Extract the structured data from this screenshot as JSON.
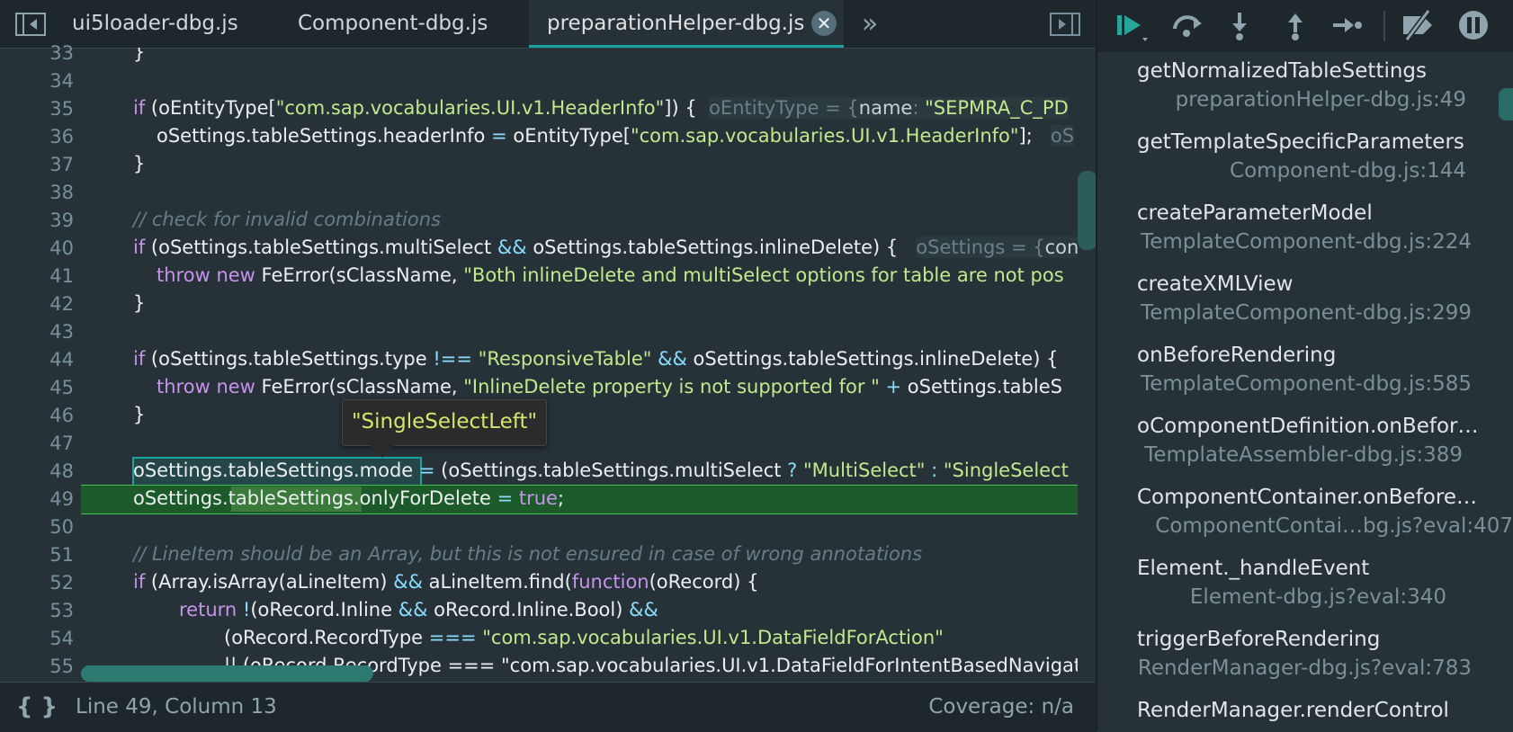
{
  "tabs": [
    {
      "label": "ui5loader-dbg.js",
      "active": false
    },
    {
      "label": "Component-dbg.js",
      "active": false
    },
    {
      "label": "preparationHelper-dbg.js",
      "active": true
    }
  ],
  "tab_close_glyph": "✕",
  "tab_overflow_glyph": "»",
  "gutter": [
    "33",
    "34",
    "35",
    "36",
    "37",
    "38",
    "39",
    "40",
    "41",
    "42",
    "43",
    "44",
    "45",
    "46",
    "47",
    "48",
    "49",
    "50",
    "51",
    "52",
    "53",
    "54",
    "55"
  ],
  "code": {
    "l33": "}",
    "l35_a": "if",
    "l35_b": " (oEntityType[",
    "l35_c": "\"com.sap.vocabularies.UI.v1.HeaderInfo\"",
    "l35_d": "]) {",
    "l35_hint_a": "oEntityType = {",
    "l35_hint_b": "name",
    "l35_hint_c": ": ",
    "l35_hint_d": "\"SEPMRA_C_PD",
    "l36_a": "oSettings.tableSettings.headerInfo ",
    "l36_b": "=",
    "l36_c": " oEntityType[",
    "l36_d": "\"com.sap.vocabularies.UI.v1.HeaderInfo\"",
    "l36_e": "];",
    "l36_hint": "oS",
    "l37": "}",
    "l39": "// check for invalid combinations",
    "l40_a": "if",
    "l40_b": " (oSettings.tableSettings.multiSelect ",
    "l40_c": "&&",
    "l40_d": " oSettings.tableSettings.inlineDelete) {",
    "l40_hint_a": "oSettings = {",
    "l40_hint_b": "con",
    "l41_a": "throw",
    "l41_b": " ",
    "l41_c": "new",
    "l41_d": " FeError(sClassName, ",
    "l41_e": "\"Both inlineDelete and multiSelect options for table are not pos",
    "l42": "}",
    "l44_a": "if",
    "l44_b": " (oSettings.tableSettings.type ",
    "l44_c": "!==",
    "l44_d": " ",
    "l44_e": "\"ResponsiveTable\"",
    "l44_f": " ",
    "l44_g": "&&",
    "l44_h": " oSettings.tableSettings.inlineDelete) {",
    "l45_a": "throw",
    "l45_b": " ",
    "l45_c": "new",
    "l45_d": " FeError(sClassName, ",
    "l45_e": "\"InlineDelete property is not supported for \"",
    "l45_f": " + ",
    "l45_g": "oSettings.tableS",
    "l46": "}",
    "l48_a": "oSettings.tableSettings.mode",
    "l48_b": " = ",
    "l48_c": "(oSettings.tableSettings.multiSelect ",
    "l48_d": "?",
    "l48_e": " ",
    "l48_f": "\"MultiSelect\"",
    "l48_g": " : ",
    "l48_h": "\"SingleSelect",
    "l49_a": "oSettings.",
    "l49_b": "tableSettings.",
    "l49_c": "onlyForDelete ",
    "l49_d": "=",
    "l49_e": " ",
    "l49_f": "true",
    "l49_g": ";",
    "l51": "// LineItem should be an Array, but this is not ensured in case of wrong annotations",
    "l52_a": "if",
    "l52_b": " (Array.isArray(aLineItem) ",
    "l52_c": "&&",
    "l52_d": " aLineItem.find(",
    "l52_e": "function",
    "l52_f": "(oRecord) {",
    "l53_a": "return",
    "l53_b": " ",
    "l53_c": "!",
    "l53_d": "(oRecord.Inline ",
    "l53_e": "&&",
    "l53_f": " oRecord.Inline.Bool) ",
    "l53_g": "&&",
    "l54_a": "(oRecord.RecordType ",
    "l54_b": "===",
    "l54_c": " ",
    "l54_d": "\"com.sap.vocabularies.UI.v1.DataFieldForAction\"",
    "l55": "|| (oRecord.RecordType === \"com.sap.vocabularies.UI.v1.DataFieldForIntentBasedNavigat"
  },
  "tooltip": "\"SingleSelectLeft\"",
  "status": {
    "braces": "{ }",
    "position": "Line 49, Column 13",
    "coverage": "Coverage: n/a"
  },
  "callstack": [
    {
      "name": "getNormalizedTableSettings",
      "loc": "preparationHelper-dbg.js:49"
    },
    {
      "name": "getTemplateSpecificParameters",
      "loc": "Component-dbg.js:144"
    },
    {
      "name": "createParameterModel",
      "loc": "TemplateComponent-dbg.js:224"
    },
    {
      "name": "createXMLView",
      "loc": "TemplateComponent-dbg.js:299"
    },
    {
      "name": "onBeforeRendering",
      "loc": "TemplateComponent-dbg.js:585"
    },
    {
      "name": "oComponentDefinition.onBefor…",
      "loc": "TemplateAssembler-dbg.js:389"
    },
    {
      "name": "ComponentContainer.onBefore…",
      "loc": "ComponentContai…bg.js?eval:407"
    },
    {
      "name": "Element._handleEvent",
      "loc": "Element-dbg.js?eval:340"
    },
    {
      "name": "triggerBeforeRendering",
      "loc": "RenderManager-dbg.js?eval:783"
    },
    {
      "name": "RenderManager.renderControl",
      "loc": ""
    }
  ],
  "colors": {
    "accent": "#1aa3a3",
    "execution_line": "#1d5a2a",
    "string": "#c3e88d",
    "keyword": "#c792ea",
    "operator": "#89ddff"
  },
  "icons": [
    "toggle-sidebar-left-icon",
    "toggle-sidebar-right-icon",
    "resume-icon",
    "step-over-icon",
    "step-into-icon",
    "step-out-icon",
    "step-icon",
    "deactivate-breakpoints-icon",
    "pause-on-exceptions-icon",
    "pretty-print-icon"
  ]
}
